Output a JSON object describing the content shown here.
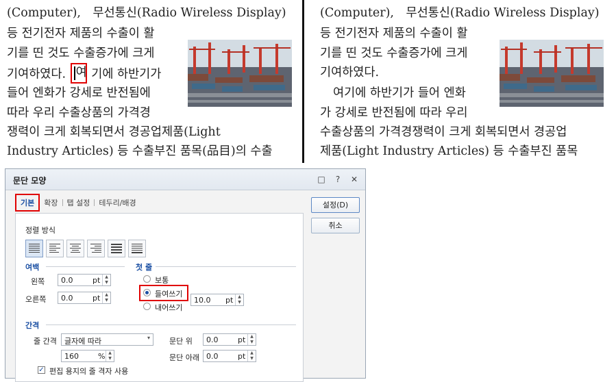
{
  "document_left": {
    "lines": [
      "(Computer),　무선통신(Radio Wireless Display)",
      "등 전기전자 제품의 수출이 활",
      "기를 띤 것도 수출증가에 크게",
      "기여하였다.",
      "여",
      "기에 하반기가",
      "들어 엔화가 강세로 반전됨에",
      "따라 우리 수출상품의 가격경",
      "쟁력이 크게 회복되면서 경공업제품(Light",
      "Industry Articles) 등 수출부진 품목(品目)의 수출"
    ]
  },
  "document_right": {
    "lines": [
      "(Computer),　무선통신(Radio Wireless Display)",
      "등 전기전자 제품의 수출이 활",
      "기를 띤 것도 수출증가에 크게",
      "기여하였다.",
      "여기에 하반기가 들어 엔화",
      "가 강세로 반전됨에 따라 우리",
      "수출상품의 가격경쟁력이 크게 회복되면서 경공업",
      "제품(Light Industry Articles) 등 수출부진 품목"
    ]
  },
  "dialog": {
    "title": "문단 모양",
    "tabs": [
      "기본",
      "확장",
      "탭 설정",
      "테두리/배경"
    ],
    "buttons": {
      "ok": "설정(D)",
      "cancel": "취소"
    },
    "alignment": {
      "label": "정렬 방식",
      "options": [
        "justify",
        "left",
        "center",
        "right",
        "distribute",
        "divide"
      ],
      "selected": "justify"
    },
    "margin": {
      "heading": "여백",
      "left_label": "왼쪽",
      "left_value": "0.0",
      "right_label": "오른쪽",
      "right_value": "0.0",
      "unit": "pt"
    },
    "first_line": {
      "heading": "첫 줄",
      "options": [
        "보통",
        "들여쓰기",
        "내어쓰기"
      ],
      "selected": "들여쓰기",
      "indent_value": "10.0",
      "unit": "pt"
    },
    "spacing": {
      "heading": "간격",
      "line_spacing_label": "줄 간격",
      "line_spacing_type": "글자에 따라",
      "line_spacing_value": "160",
      "line_spacing_unit": "%",
      "above_label": "문단 위",
      "above_value": "0.0",
      "below_label": "문단 아래",
      "below_value": "0.0",
      "unit": "pt",
      "grid_checkbox_label": "편집 용지의 줄 격자 사용",
      "grid_checked": true
    }
  },
  "colors": {
    "highlight_red": "#e00000",
    "accent_blue": "#1a4fa3"
  }
}
